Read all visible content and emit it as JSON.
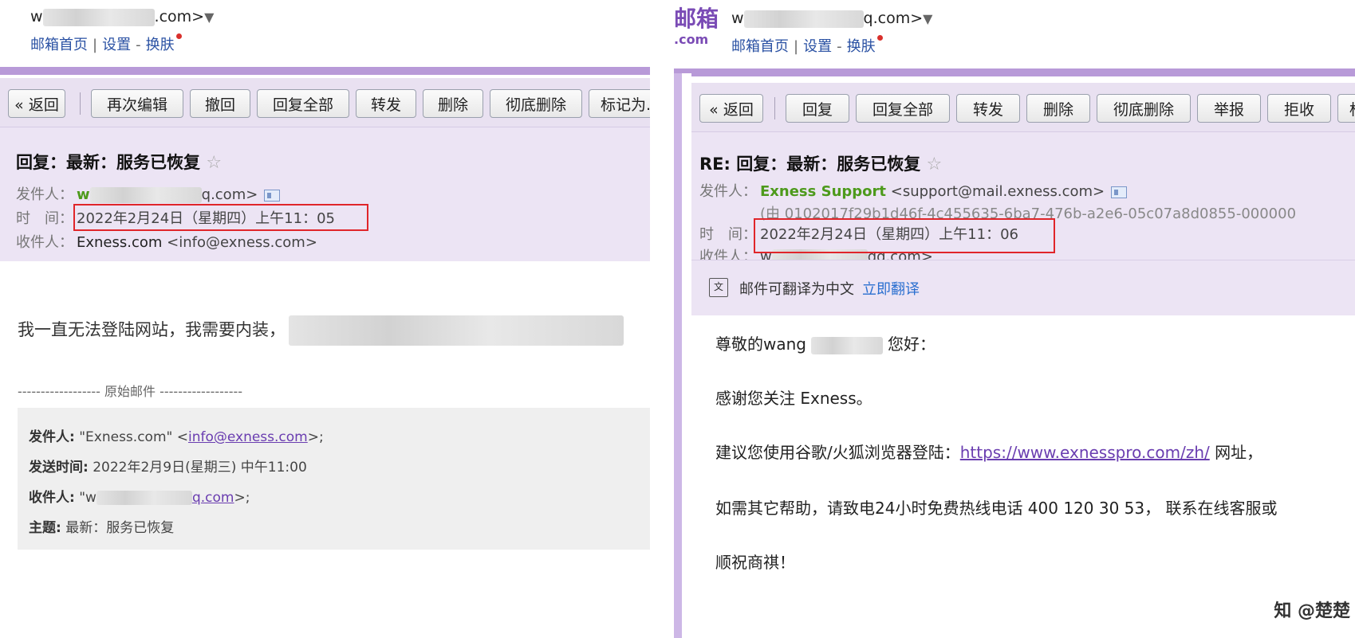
{
  "left": {
    "account_prefix": "w",
    "account_suffix": ".com>",
    "account_arrow": "▼",
    "links": [
      "邮箱首页",
      "设置",
      "换肤"
    ],
    "toolbar": [
      "« 返回",
      "再次编辑",
      "撤回",
      "回复全部",
      "转发",
      "删除",
      "彻底删除",
      "标记为..."
    ],
    "subject": "回复：最新：服务已恢复",
    "star": "☆",
    "from_label": "发件人：",
    "from_prefix": "w",
    "from_suffix": "q.com>",
    "time_label": "时　间：",
    "time_value": "2022年2月24日（星期四）上午11：05",
    "to_label": "收件人：",
    "to_name": "Exness.com",
    "to_email": "<info@exness.com>",
    "body_line": "我一直无法登陆网站，我需要内装，",
    "orig_separator": "------------------ 原始邮件 ------------------",
    "quote": {
      "from_label": "发件人:",
      "from_name": "\"Exness.com\" <",
      "from_email": "info@exness.com",
      "from_end": ">;",
      "sent_label": "发送时间:",
      "sent_value": "2022年2月9日(星期三) 中午11:00",
      "to_label": "收件人:",
      "to_prefix": "\"w",
      "to_email_suffix": "q.com",
      "to_end": ">;",
      "subject_label": "主题:",
      "subject_value": "最新：服务已恢复"
    }
  },
  "right": {
    "logo_text": "邮箱",
    "logo_com": ".com",
    "account_prefix": "w",
    "account_suffix": "q.com>",
    "account_arrow": "▼",
    "links": [
      "邮箱首页",
      "设置",
      "换肤"
    ],
    "toolbar": [
      "« 返回",
      "回复",
      "回复全部",
      "转发",
      "删除",
      "彻底删除",
      "举报",
      "拒收",
      "标"
    ],
    "subject": "RE: 回复：最新：服务已恢复",
    "star": "☆",
    "from_label": "发件人：",
    "from_name": "Exness Support",
    "from_email": "<support@mail.exness.com>",
    "from_via": "(由 0102017f29b1d46f-4c455635-6ba7-476b-a2e6-05c07a8d0855-000000",
    "time_label": "时　间：",
    "time_value": "2022年2月24日（星期四）上午11：06",
    "to_label": "收件人：",
    "to_prefix": "w",
    "to_suffix": "qq.com>",
    "translate_icon": "文",
    "translate_text": "邮件可翻译为中文",
    "translate_link": "立即翻译",
    "greeting_a": "尊敬的wang",
    "greeting_b": "您好：",
    "line1": "感谢您关注 Exness。",
    "line2_prefix": "建议您使用谷歌/火狐浏览器登陆：",
    "line2_link": "https://www.exnesspro.com/zh/",
    "line2_suffix": " 网址，",
    "line3": "如需其它帮助，请致电24小时免费热线电话 400 120 30 53， 联系在线客服或",
    "line4": "顺祝商祺！",
    "watermark": "知 @楚楚"
  },
  "colors": {
    "accent_purple": "#b89ad8",
    "toolbar_bg": "#e9e1f1",
    "link_blue": "#2a51a3",
    "sender_green": "#4d9a1c",
    "highlight_red": "#e0252a"
  }
}
